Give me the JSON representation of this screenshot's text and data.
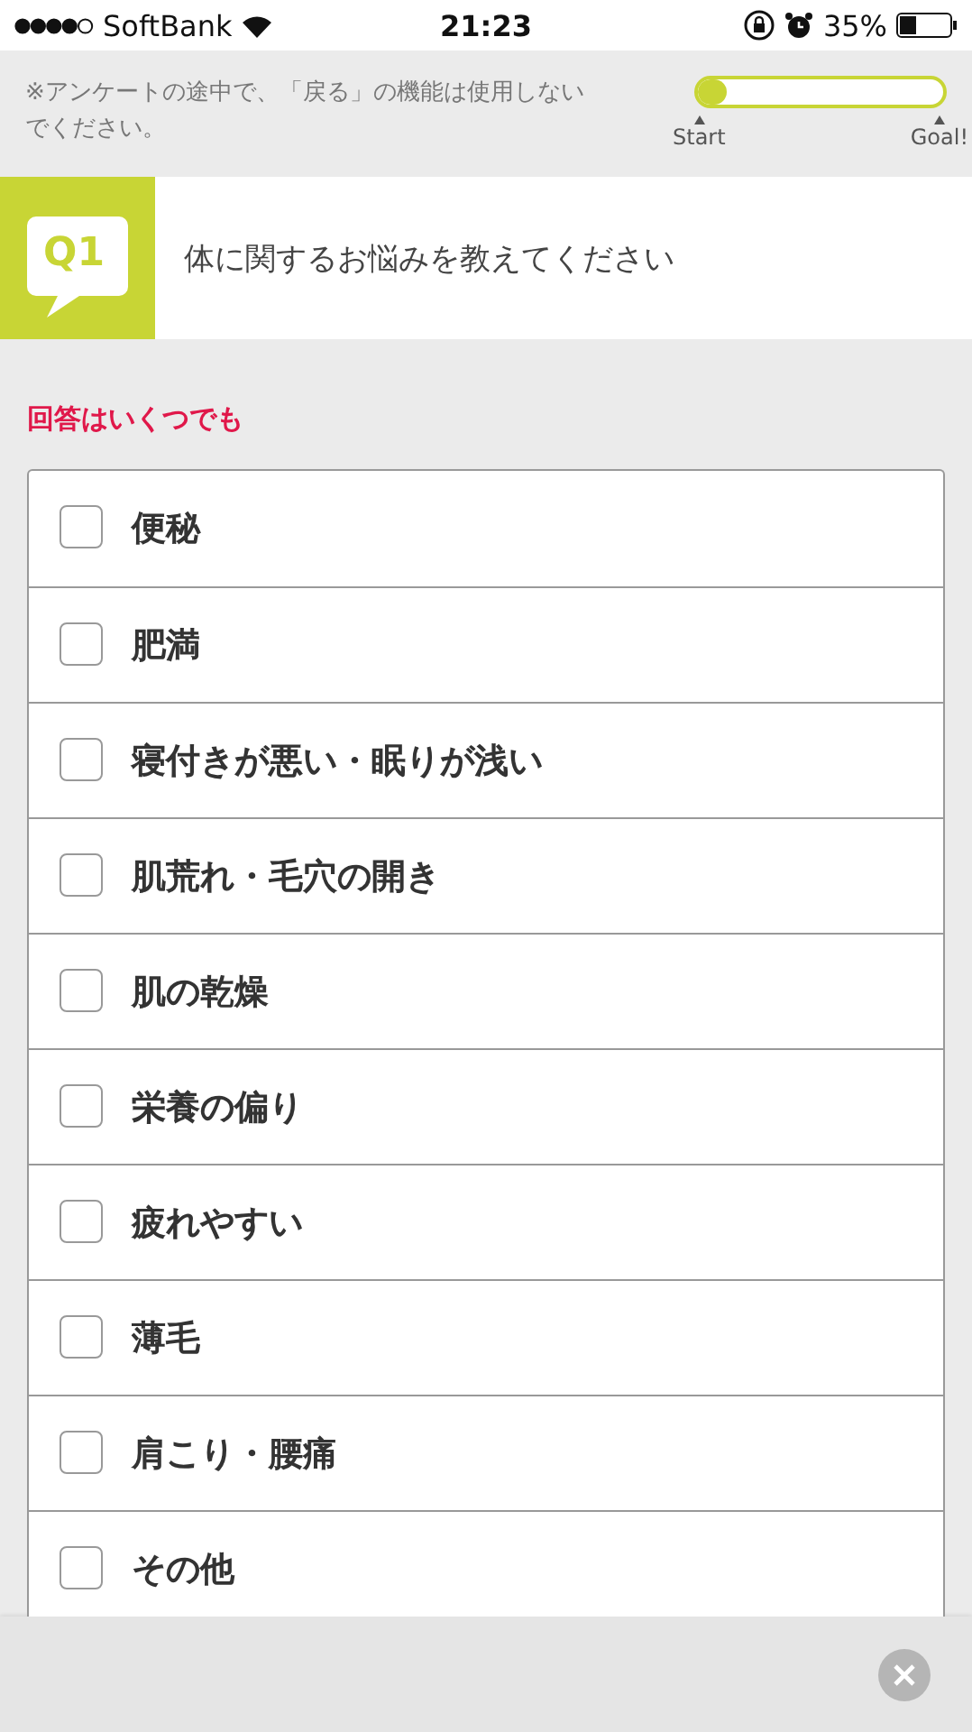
{
  "status_bar": {
    "carrier": "SoftBank",
    "time": "21:23",
    "battery": "35%"
  },
  "notice": {
    "text": "※アンケートの途中で、「戻る」の機能は使用しないでください。",
    "progress": {
      "level": 0.12,
      "start_label": "Start",
      "goal_label": "Goal!"
    }
  },
  "question": {
    "number": "Q1",
    "text": "体に関するお悩みを教えてください"
  },
  "hint": "回答はいくつでも",
  "options": [
    {
      "label": "便秘",
      "checked": false
    },
    {
      "label": "肥満",
      "checked": false
    },
    {
      "label": "寝付きが悪い・眠りが浅い",
      "checked": false
    },
    {
      "label": "肌荒れ・毛穴の開き",
      "checked": false
    },
    {
      "label": "肌の乾燥",
      "checked": false
    },
    {
      "label": "栄養の偏り",
      "checked": false
    },
    {
      "label": "疲れやすい",
      "checked": false
    },
    {
      "label": "薄毛",
      "checked": false
    },
    {
      "label": "肩こり・腰痛",
      "checked": false
    },
    {
      "label": "その他",
      "checked": false
    }
  ]
}
